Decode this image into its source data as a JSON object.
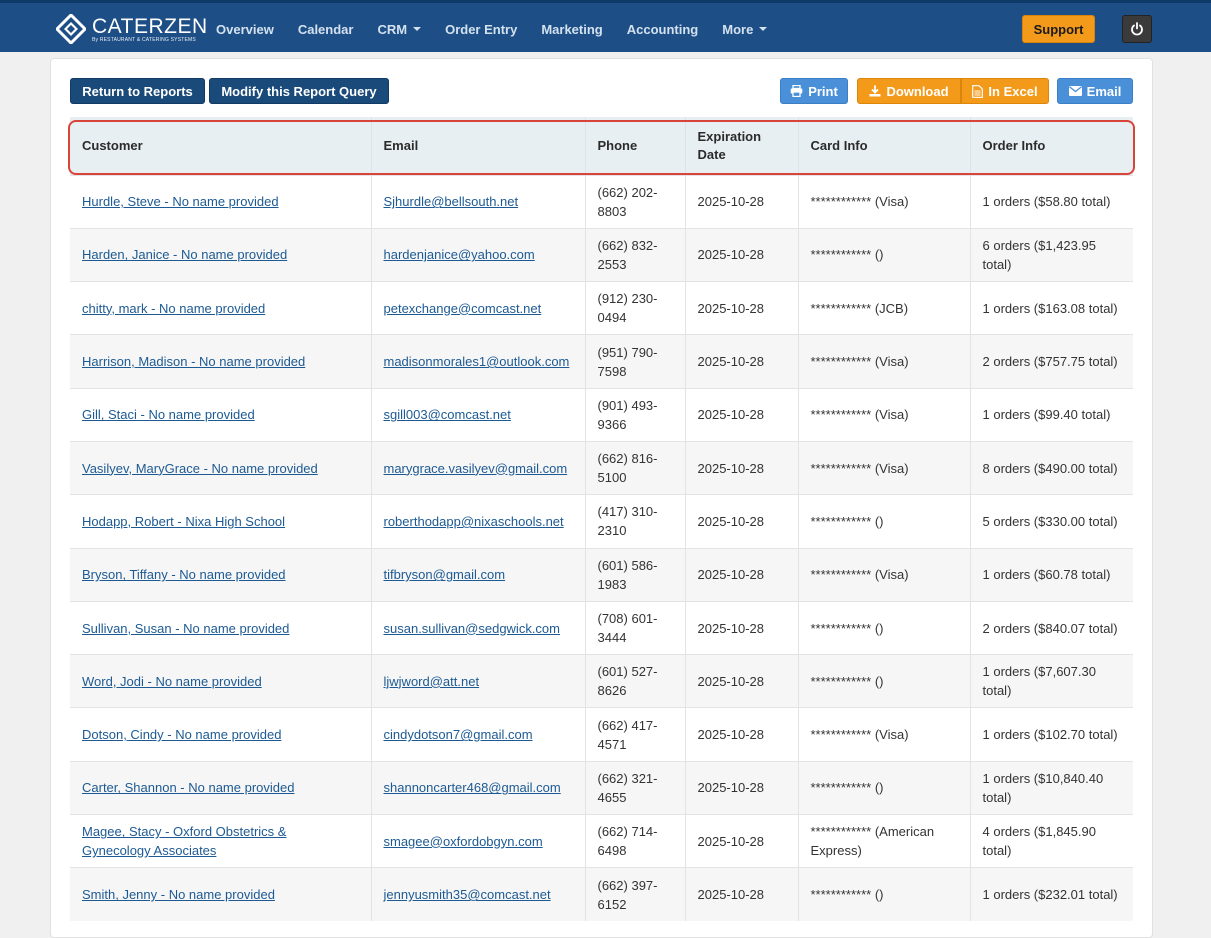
{
  "brand": {
    "name": "CATERZEN",
    "tagline": "By RESTAURANT & CATERING SYSTEMS"
  },
  "nav": {
    "items": [
      {
        "label": "Overview"
      },
      {
        "label": "Calendar"
      },
      {
        "label": "CRM",
        "dropdown": true
      },
      {
        "label": "Order Entry"
      },
      {
        "label": "Marketing"
      },
      {
        "label": "Accounting"
      },
      {
        "label": "More",
        "dropdown": true
      }
    ],
    "support_label": "Support"
  },
  "toolbar": {
    "return_label": "Return to Reports",
    "modify_label": "Modify this Report Query",
    "print_label": "Print",
    "download_label": "Download",
    "excel_label": "In Excel",
    "email_label": "Email"
  },
  "colors": {
    "nav": "#1d4f86",
    "accent_orange": "#f39a1a",
    "link": "#1d5a93",
    "highlight": "#d9443a"
  },
  "table": {
    "headers": [
      "Customer",
      "Email",
      "Phone",
      "Expiration Date",
      "Card Info",
      "Order Info"
    ],
    "rows": [
      [
        "Hurdle, Steve - No name provided",
        "Sjhurdle@bellsouth.net",
        "(662) 202-8803",
        "2025-10-28",
        "************ (Visa)",
        "1 orders ($58.80 total)"
      ],
      [
        "Harden, Janice - No name provided",
        "hardenjanice@yahoo.com",
        "(662) 832-2553",
        "2025-10-28",
        "************ ()",
        "6 orders ($1,423.95 total)"
      ],
      [
        "chitty, mark - No name provided",
        "petexchange@comcast.net",
        "(912) 230-0494",
        "2025-10-28",
        "************ (JCB)",
        "1 orders ($163.08 total)"
      ],
      [
        "Harrison, Madison - No name provided",
        "madisonmorales1@outlook.com",
        "(951) 790-7598",
        "2025-10-28",
        "************ (Visa)",
        "2 orders ($757.75 total)"
      ],
      [
        "Gill, Staci - No name provided",
        "sgill003@comcast.net",
        "(901) 493-9366",
        "2025-10-28",
        "************ (Visa)",
        "1 orders ($99.40 total)"
      ],
      [
        "Vasilyev, MaryGrace - No name provided",
        "marygrace.vasilyev@gmail.com",
        "(662) 816-5100",
        "2025-10-28",
        "************ (Visa)",
        "8 orders ($490.00 total)"
      ],
      [
        "Hodapp, Robert - Nixa High School",
        "roberthodapp@nixaschools.net",
        "(417) 310-2310",
        "2025-10-28",
        "************ ()",
        "5 orders ($330.00 total)"
      ],
      [
        "Bryson, Tiffany - No name provided",
        "tifbryson@gmail.com",
        "(601) 586-1983",
        "2025-10-28",
        "************ (Visa)",
        "1 orders ($60.78 total)"
      ],
      [
        "Sullivan, Susan - No name provided",
        "susan.sullivan@sedgwick.com",
        "(708) 601-3444",
        "2025-10-28",
        "************ ()",
        "2 orders ($840.07 total)"
      ],
      [
        "Word, Jodi - No name provided",
        "ljwjword@att.net",
        "(601) 527-8626",
        "2025-10-28",
        "************ ()",
        "1 orders ($7,607.30 total)"
      ],
      [
        "Dotson, Cindy - No name provided",
        "cindydotson7@gmail.com",
        "(662) 417-4571",
        "2025-10-28",
        "************ (Visa)",
        "1 orders ($102.70 total)"
      ],
      [
        "Carter, Shannon - No name provided",
        "shannoncarter468@gmail.com",
        "(662) 321-4655",
        "2025-10-28",
        "************ ()",
        "1 orders ($10,840.40 total)"
      ],
      [
        "Magee, Stacy - Oxford Obstetrics & Gynecology Associates",
        "smagee@oxfordobgyn.com",
        "(662) 714-6498",
        "2025-10-28",
        "************ (American Express)",
        "4 orders ($1,845.90 total)"
      ],
      [
        "Smith, Jenny - No name provided",
        "jennyusmith35@comcast.net",
        "(662) 397-6152",
        "2025-10-28",
        "************ ()",
        "1 orders ($232.01 total)"
      ]
    ]
  }
}
